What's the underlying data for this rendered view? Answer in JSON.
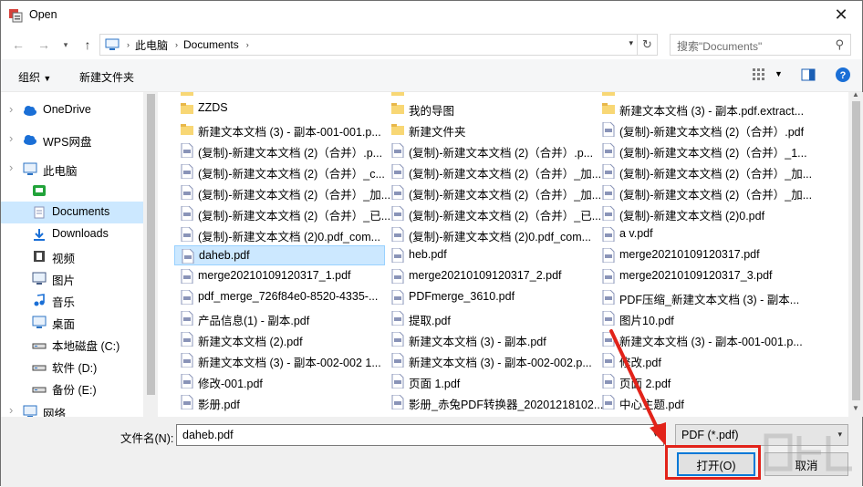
{
  "window": {
    "title": "Open"
  },
  "address": {
    "segments": [
      "此电脑",
      "Documents"
    ]
  },
  "search": {
    "placeholder": "搜索\"Documents\""
  },
  "toolbar": {
    "organize": "组织",
    "new_folder": "新建文件夹"
  },
  "sidebar": {
    "items": [
      {
        "label": "OneDrive",
        "icon": "cloud-icon"
      },
      {
        "label": "WPS网盘",
        "icon": "cloud-icon"
      },
      {
        "label": "此电脑",
        "icon": "computer-icon"
      },
      {
        "label": "",
        "icon": "app-icon"
      },
      {
        "label": "Documents",
        "icon": "document-icon",
        "selected": true
      },
      {
        "label": "Downloads",
        "icon": "download-icon"
      },
      {
        "label": "视频",
        "icon": "video-icon"
      },
      {
        "label": "图片",
        "icon": "image-icon"
      },
      {
        "label": "音乐",
        "icon": "music-icon"
      },
      {
        "label": "桌面",
        "icon": "desktop-icon"
      },
      {
        "label": "本地磁盘 (C:)",
        "icon": "drive-icon"
      },
      {
        "label": "软件 (D:)",
        "icon": "drive-icon"
      },
      {
        "label": "备份 (E:)",
        "icon": "drive-icon"
      },
      {
        "label": "网络",
        "icon": "network-icon"
      }
    ]
  },
  "files": {
    "col1": [
      {
        "name": "ZZDS",
        "type": "folder"
      },
      {
        "name": "新建文本文档 (3) - 副本-001-001.p...",
        "type": "folder"
      },
      {
        "name": "(复制)-新建文本文档 (2)（合并）.p...",
        "type": "pdf"
      },
      {
        "name": "(复制)-新建文本文档 (2)（合并）_c...",
        "type": "pdf"
      },
      {
        "name": "(复制)-新建文本文档 (2)（合并）_加...",
        "type": "pdf"
      },
      {
        "name": "(复制)-新建文本文档 (2)（合并）_已...",
        "type": "pdf"
      },
      {
        "name": "(复制)-新建文本文档 (2)0.pdf_com...",
        "type": "pdf"
      },
      {
        "name": "daheb.pdf",
        "type": "pdf",
        "selected": true
      },
      {
        "name": "merge20210109120317_1.pdf",
        "type": "pdf"
      },
      {
        "name": "pdf_merge_726f84e0-8520-4335-...",
        "type": "pdf"
      },
      {
        "name": "产品信息(1) - 副本.pdf",
        "type": "pdf"
      },
      {
        "name": "新建文本文档 (2).pdf",
        "type": "pdf"
      },
      {
        "name": "新建文本文档 (3) - 副本-002-002 1...",
        "type": "pdf"
      },
      {
        "name": "修改-001.pdf",
        "type": "pdf"
      },
      {
        "name": "影册.pdf",
        "type": "pdf"
      }
    ],
    "col2": [
      {
        "name": "我的导图",
        "type": "folder"
      },
      {
        "name": "新建文件夹",
        "type": "folder"
      },
      {
        "name": "(复制)-新建文本文档 (2)（合并）.p...",
        "type": "pdf"
      },
      {
        "name": "(复制)-新建文本文档 (2)（合并）_加...",
        "type": "pdf"
      },
      {
        "name": "(复制)-新建文本文档 (2)（合并）_加...",
        "type": "pdf"
      },
      {
        "name": "(复制)-新建文本文档 (2)（合并）_已...",
        "type": "pdf"
      },
      {
        "name": "(复制)-新建文本文档 (2)0.pdf_com...",
        "type": "pdf"
      },
      {
        "name": "heb.pdf",
        "type": "pdf"
      },
      {
        "name": "merge20210109120317_2.pdf",
        "type": "pdf"
      },
      {
        "name": "PDFmerge_3610.pdf",
        "type": "pdf"
      },
      {
        "name": "提取.pdf",
        "type": "pdf"
      },
      {
        "name": "新建文本文档 (3) - 副本.pdf",
        "type": "pdf"
      },
      {
        "name": "新建文本文档 (3) - 副本-002-002.p...",
        "type": "pdf"
      },
      {
        "name": "页面 1.pdf",
        "type": "pdf"
      },
      {
        "name": "影册_赤兔PDF转换器_20201218102...",
        "type": "pdf"
      }
    ],
    "col3": [
      {
        "name": "新建文本文档 (3) - 副本.pdf.extract...",
        "type": "folder"
      },
      {
        "name": "(复制)-新建文本文档 (2)（合并）.pdf",
        "type": "pdf"
      },
      {
        "name": "(复制)-新建文本文档 (2)（合并）_1...",
        "type": "pdf"
      },
      {
        "name": "(复制)-新建文本文档 (2)（合并）_加...",
        "type": "pdf"
      },
      {
        "name": "(复制)-新建文本文档 (2)（合并）_加...",
        "type": "pdf"
      },
      {
        "name": "(复制)-新建文本文档 (2)0.pdf",
        "type": "pdf"
      },
      {
        "name": "a v.pdf",
        "type": "pdf"
      },
      {
        "name": "merge20210109120317.pdf",
        "type": "pdf"
      },
      {
        "name": "merge20210109120317_3.pdf",
        "type": "pdf"
      },
      {
        "name": "PDF压缩_新建文本文档 (3) - 副本...",
        "type": "pdf"
      },
      {
        "name": "图片10.pdf",
        "type": "pdf"
      },
      {
        "name": "新建文本文档 (3) - 副本-001-001.p...",
        "type": "pdf"
      },
      {
        "name": "修改.pdf",
        "type": "pdf"
      },
      {
        "name": "页面 2.pdf",
        "type": "pdf"
      },
      {
        "name": "中心主题.pdf",
        "type": "pdf"
      }
    ]
  },
  "bottom": {
    "filename_label": "文件名(N):",
    "filename_value": "daheb.pdf",
    "filter_value": "PDF (*.pdf)",
    "open_label": "打开(O)",
    "cancel_label": "取消"
  },
  "colors": {
    "accent": "#0078d7",
    "selection": "#cce8ff",
    "highlight": "#e2231a",
    "folder": "#f8d775",
    "pdf": "#8a94b8"
  }
}
